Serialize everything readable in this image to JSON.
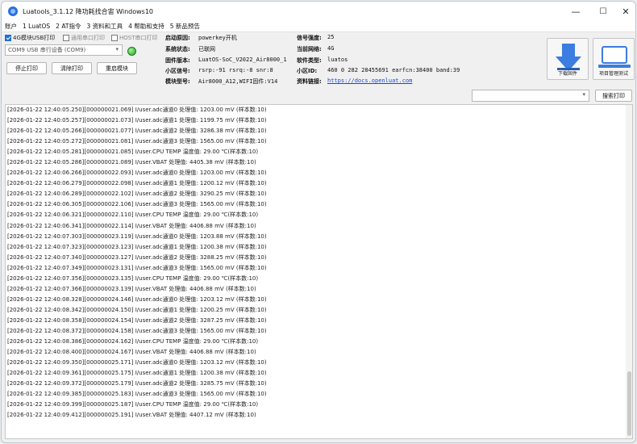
{
  "window": {
    "title": "Luatools_3.1.12 降功耗找合宙 Windows10",
    "min_glyph": "—",
    "max_glyph": "☐",
    "close_glyph": "✕"
  },
  "menu": [
    "账户",
    "1 LuatOS",
    "2 AT指令",
    "3 资料和工具",
    "4 帮助和支持",
    "5 新品预告"
  ],
  "options": {
    "usb_print": "4G模块USB打印",
    "serial_print": "通用串口打印",
    "host_print": "HOST串口打印"
  },
  "port_select": {
    "value": "COM9 USB 串行设备 (COM9)"
  },
  "buttons": {
    "stop_print": "停止打印",
    "clear_print": "清除打印",
    "restart_module": "重启模块",
    "download_firmware": "下载固件",
    "project_manage": "项目管理测试",
    "search_print": "搜索打印"
  },
  "device_info": {
    "boot_reason_label": "启动原因:",
    "boot_reason": "powerkey开机",
    "system_state_label": "系统状态:",
    "system_state": "已联网",
    "firmware_label": "固件版本:",
    "firmware": "LuatOS-SoC_V2022_Air8000_1",
    "cell_signal_label": "小区信号:",
    "cell_signal": "rsrp:-91 rsrq:-8 snr:8",
    "module_label": "模块型号:",
    "module": "Air8000_A12,WIFI固件:V14",
    "signal_strength_label": "信号强度:",
    "signal_strength": "25",
    "network_label": "当前网络:",
    "network": "4G",
    "software_label": "软件类型:",
    "software": "luatos",
    "cell_id_label": "小区ID:",
    "cell_id": "460 0 282 28455691 earfcn:38400 band:39",
    "docs_label": "资料链接:",
    "docs_link": "https://docs.openluat.com"
  },
  "colors": {
    "link": "#1a48d6",
    "status_online": "#22a323",
    "checkbox_accent": "#1f6fd8",
    "download_icon": "#3b7de0"
  },
  "log_lines": [
    "[2026-01-22 12:40:05.250][000000021.069] I/user.adc通道0 处理值: 1203.00 mV (样本数:10)",
    "[2026-01-22 12:40:05.257][000000021.073] I/user.adc通道1 处理值: 1199.75 mV (样本数:10)",
    "[2026-01-22 12:40:05.266][000000021.077] I/user.adc通道2 处理值: 3286.38 mV (样本数:10)",
    "[2026-01-22 12:40:05.272][000000021.081] I/user.adc通道3 处理值: 1565.00 mV (样本数:10)",
    "[2026-01-22 12:40:05.281][000000021.085] I/user.CPU TEMP 温度值: 29.00 ℃(样本数:10)",
    "[2026-01-22 12:40:05.286][000000021.089] I/user.VBAT 处理值: 4405.38 mV (样本数:10)",
    "[2026-01-22 12:40:06.266][000000022.093] I/user.adc通道0 处理值: 1203.00 mV (样本数:10)",
    "[2026-01-22 12:40:06.279][000000022.098] I/user.adc通道1 处理值: 1200.12 mV (样本数:10)",
    "[2026-01-22 12:40:06.289][000000022.102] I/user.adc通道2 处理值: 3290.25 mV (样本数:10)",
    "[2026-01-22 12:40:06.305][000000022.106] I/user.adc通道3 处理值: 1565.00 mV (样本数:10)",
    "[2026-01-22 12:40:06.321][000000022.110] I/user.CPU TEMP 温度值: 29.00 ℃(样本数:10)",
    "[2026-01-22 12:40:06.341][000000022.114] I/user.VBAT 处理值: 4406.88 mV (样本数:10)",
    "[2026-01-22 12:40:07.303][000000023.119] I/user.adc通道0 处理值: 1203.88 mV (样本数:10)",
    "[2026-01-22 12:40:07.323][000000023.123] I/user.adc通道1 处理值: 1200.38 mV (样本数:10)",
    "[2026-01-22 12:40:07.340][000000023.127] I/user.adc通道2 处理值: 3288.25 mV (样本数:10)",
    "[2026-01-22 12:40:07.349][000000023.131] I/user.adc通道3 处理值: 1565.00 mV (样本数:10)",
    "[2026-01-22 12:40:07.356][000000023.135] I/user.CPU TEMP 温度值: 29.00 ℃(样本数:10)",
    "[2026-01-22 12:40:07.366][000000023.139] I/user.VBAT 处理值: 4406.88 mV (样本数:10)",
    "[2026-01-22 12:40:08.328][000000024.146] I/user.adc通道0 处理值: 1203.12 mV (样本数:10)",
    "[2026-01-22 12:40:08.342][000000024.150] I/user.adc通道1 处理值: 1200.25 mV (样本数:10)",
    "[2026-01-22 12:40:08.358][000000024.154] I/user.adc通道2 处理值: 3287.25 mV (样本数:10)",
    "[2026-01-22 12:40:08.372][000000024.158] I/user.adc通道3 处理值: 1565.00 mV (样本数:10)",
    "[2026-01-22 12:40:08.386][000000024.162] I/user.CPU TEMP 温度值: 29.00 ℃(样本数:10)",
    "[2026-01-22 12:40:08.400][000000024.167] I/user.VBAT 处理值: 4406.88 mV (样本数:10)",
    "[2026-01-22 12:40:09.350][000000025.171] I/user.adc通道0 处理值: 1203.12 mV (样本数:10)",
    "[2026-01-22 12:40:09.361][000000025.175] I/user.adc通道1 处理值: 1200.38 mV (样本数:10)",
    "[2026-01-22 12:40:09.372][000000025.179] I/user.adc通道2 处理值: 3285.75 mV (样本数:10)",
    "[2026-01-22 12:40:09.385][000000025.183] I/user.adc通道3 处理值: 1565.00 mV (样本数:10)",
    "[2026-01-22 12:40:09.399][000000025.187] I/user.CPU TEMP 温度值: 29.00 ℃(样本数:10)",
    "[2026-01-22 12:40:09.412][000000025.191] I/user.VBAT 处理值: 4407.12 mV (样本数:10)"
  ]
}
